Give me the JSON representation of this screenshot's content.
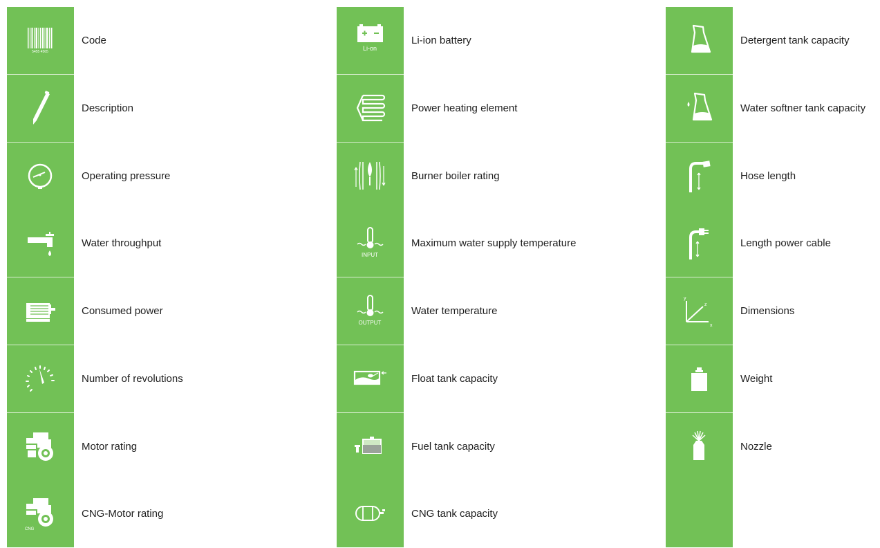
{
  "legend": {
    "column_1": [
      {
        "icon": "barcode-icon",
        "label": "Code",
        "icon_text": "5455 4565"
      },
      {
        "icon": "pen-icon",
        "label": "Description"
      },
      {
        "icon": "pressure-gauge-icon",
        "label": "Operating pressure"
      },
      {
        "icon": "water-tap-icon",
        "label": "Water throughput"
      },
      {
        "icon": "electric-motor-icon",
        "label": "Consumed power"
      },
      {
        "icon": "tachometer-icon",
        "label": "Number of revolutions"
      },
      {
        "icon": "engine-icon",
        "label": "Motor rating"
      },
      {
        "icon": "cng-engine-icon",
        "label": "CNG-Motor rating",
        "icon_text": "CNG"
      }
    ],
    "column_2": [
      {
        "icon": "battery-icon",
        "label": "Li-ion battery",
        "icon_text": "Li-on"
      },
      {
        "icon": "heating-element-icon",
        "label": "Power heating element"
      },
      {
        "icon": "burner-boiler-icon",
        "label": "Burner boiler rating"
      },
      {
        "icon": "thermometer-input-icon",
        "label": "Maximum water supply temperature",
        "icon_text": "INPUT"
      },
      {
        "icon": "thermometer-output-icon",
        "label": "Water temperature",
        "icon_text": "OUTPUT"
      },
      {
        "icon": "float-tank-icon",
        "label": "Float tank capacity"
      },
      {
        "icon": "fuel-tank-icon",
        "label": "Fuel tank capacity"
      },
      {
        "icon": "cng-tank-icon",
        "label": "CNG tank capacity"
      }
    ],
    "column_3": [
      {
        "icon": "detergent-flask-icon",
        "label": "Detergent tank capacity"
      },
      {
        "icon": "softener-flask-icon",
        "label": "Water softner tank capacity"
      },
      {
        "icon": "hose-length-icon",
        "label": "Hose length"
      },
      {
        "icon": "power-cable-icon",
        "label": "Length power cable"
      },
      {
        "icon": "dimensions-axes-icon",
        "label": "Dimensions",
        "axis_x": "x",
        "axis_y": "y",
        "axis_z": "z"
      },
      {
        "icon": "weight-icon",
        "label": "Weight"
      },
      {
        "icon": "nozzle-icon",
        "label": "Nozzle"
      }
    ]
  },
  "colors": {
    "tile": "#72c156",
    "icon": "#ffffff",
    "text": "#1e1e1e"
  }
}
